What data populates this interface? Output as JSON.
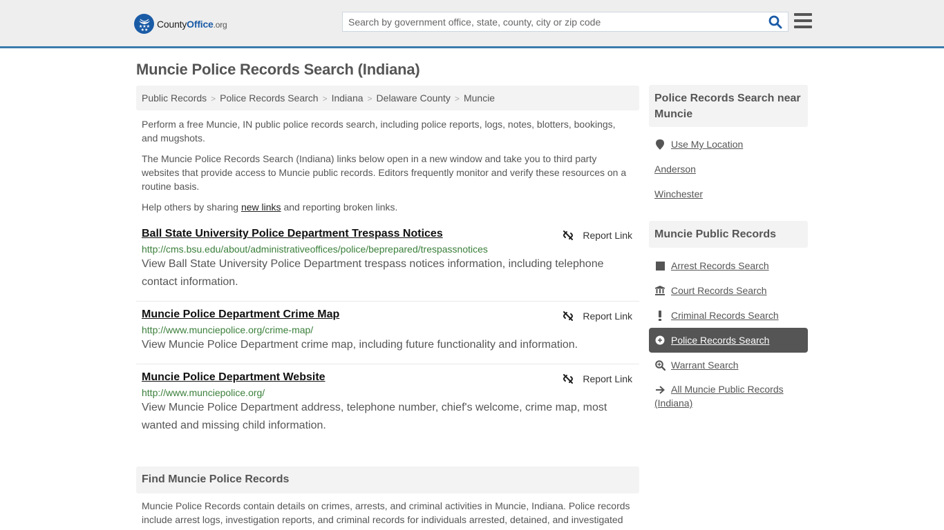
{
  "header": {
    "logo": {
      "prefix": "County",
      "brand": "Office",
      "suffix": ".org"
    },
    "search": {
      "placeholder": "Search by government office, state, county, city or zip code",
      "value": ""
    },
    "colors": {
      "brand": "#1a5ba6",
      "header_border": "#3b7bab"
    }
  },
  "page": {
    "title": "Muncie Police Records Search (Indiana)",
    "breadcrumb": [
      "Public Records",
      "Police Records Search",
      "Indiana",
      "Delaware County",
      "Muncie"
    ],
    "intro": {
      "p1": "Perform a free Muncie, IN public police records search, including police reports, logs, notes, blotters, bookings, and mugshots.",
      "p2": "The Muncie Police Records Search (Indiana) links below open in a new window and take you to third party websites that provide access to Muncie public records. Editors frequently monitor and verify these resources on a routine basis.",
      "p3_before": "Help others by sharing ",
      "p3_link": "new links",
      "p3_after": " and reporting broken links."
    },
    "results": [
      {
        "title": "Ball State University Police Department Trespass Notices",
        "url": "http://cms.bsu.edu/about/administrativeoffices/police/beprepared/trespassnotices",
        "description": "View Ball State University Police Department trespass notices information, including telephone contact information.",
        "report_label": "Report Link"
      },
      {
        "title": "Muncie Police Department Crime Map",
        "url": "http://www.munciepolice.org/crime-map/",
        "description": "View Muncie Police Department crime map, including future functionality and information.",
        "report_label": "Report Link"
      },
      {
        "title": "Muncie Police Department Website",
        "url": "http://www.munciepolice.org/",
        "description": "View Muncie Police Department address, telephone number, chief's welcome, crime map, most wanted and missing child information.",
        "report_label": "Report Link"
      }
    ],
    "find_section": {
      "heading": "Find Muncie Police Records",
      "body": "Muncie Police Records contain details on crimes, arrests, and criminal activities in Muncie, Indiana. Police records include arrest logs, investigation reports, and criminal records for individuals arrested, detained, and investigated"
    }
  },
  "sidebar": {
    "near": {
      "heading": "Police Records Search near Muncie",
      "use_location": "Use My Location",
      "cities": [
        "Anderson",
        "Winchester"
      ]
    },
    "public_records": {
      "heading": "Muncie Public Records",
      "items": [
        {
          "label": "Arrest Records Search",
          "icon": "square-icon",
          "active": false
        },
        {
          "label": "Court Records Search",
          "icon": "courthouse-icon",
          "active": false
        },
        {
          "label": "Criminal Records Search",
          "icon": "exclamation-icon",
          "active": false
        },
        {
          "label": "Police Records Search",
          "icon": "crosshair-icon",
          "active": true
        },
        {
          "label": "Warrant Search",
          "icon": "zoom-in-icon",
          "active": false
        },
        {
          "label": "All Muncie Public Records (Indiana)",
          "icon": "arrow-right-icon",
          "active": false
        }
      ]
    }
  }
}
